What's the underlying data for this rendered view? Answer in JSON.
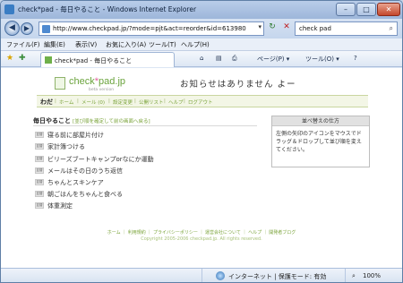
{
  "window": {
    "title": "check*pad - 毎日やること - Windows Internet Explorer",
    "minimize": "–",
    "maximize": "□",
    "close": "✕"
  },
  "nav": {
    "back": "◀",
    "forward": "▶",
    "url": "http://www.checkpad.jp/?mode=pjt&act=reorder&id=613980",
    "refresh": "↻",
    "stop": "✕",
    "search_value": "check pad",
    "search_icon": "⌕"
  },
  "menu": [
    "ファイル(F)",
    "編集(E)",
    "表示(V)",
    "お気に入り(A)",
    "ツール(T)",
    "ヘルプ(H)"
  ],
  "command_bar": {
    "tab_title": "check*pad - 毎日やること",
    "home": "⌂",
    "feeds": "▤",
    "print": "⎙",
    "page": "ページ(P) ▾",
    "tools": "ツール(O) ▾",
    "help": "?"
  },
  "site": {
    "logo_text": "check",
    "logo_dot": "*",
    "logo_tail": "pad.jp",
    "logo_sub": "beta version",
    "notice": "お知らせはありません よー",
    "user": "わだ",
    "links": [
      "ホーム",
      "メール (0)",
      "設定変更",
      "公開リスト",
      "ヘルプ",
      "ログアウト"
    ]
  },
  "list": {
    "title": "毎日やること",
    "reorder_link": "[並び順を確定して前の画面へ戻る]",
    "badge": "並替",
    "tasks": [
      "寝る前に部屋片付け",
      "家計簿つける",
      "ビリーズブートキャンプorなにか運動",
      "メールはその日のうち返信",
      "ちゃんとスキンケア",
      "朝ごはんをちゃんと食べる",
      "体重測定"
    ]
  },
  "sort_box": {
    "title": "並べ替えの仕方",
    "body": "左側の矢印のアイコンをマウスでドラッグ＆ドロップして並び順を変えてください。"
  },
  "footer": {
    "links": "ホーム ｜ 利用規約 ｜ プライバシーポリシー ｜ 運営会社について ｜ ヘルプ ｜ 開発者ブログ",
    "copyright": "Copyright 2005-2006 checkpad.jp. All rights reserved."
  },
  "status": {
    "zone": "インターネット | 保護モード: 有効",
    "zoom": "100%"
  }
}
